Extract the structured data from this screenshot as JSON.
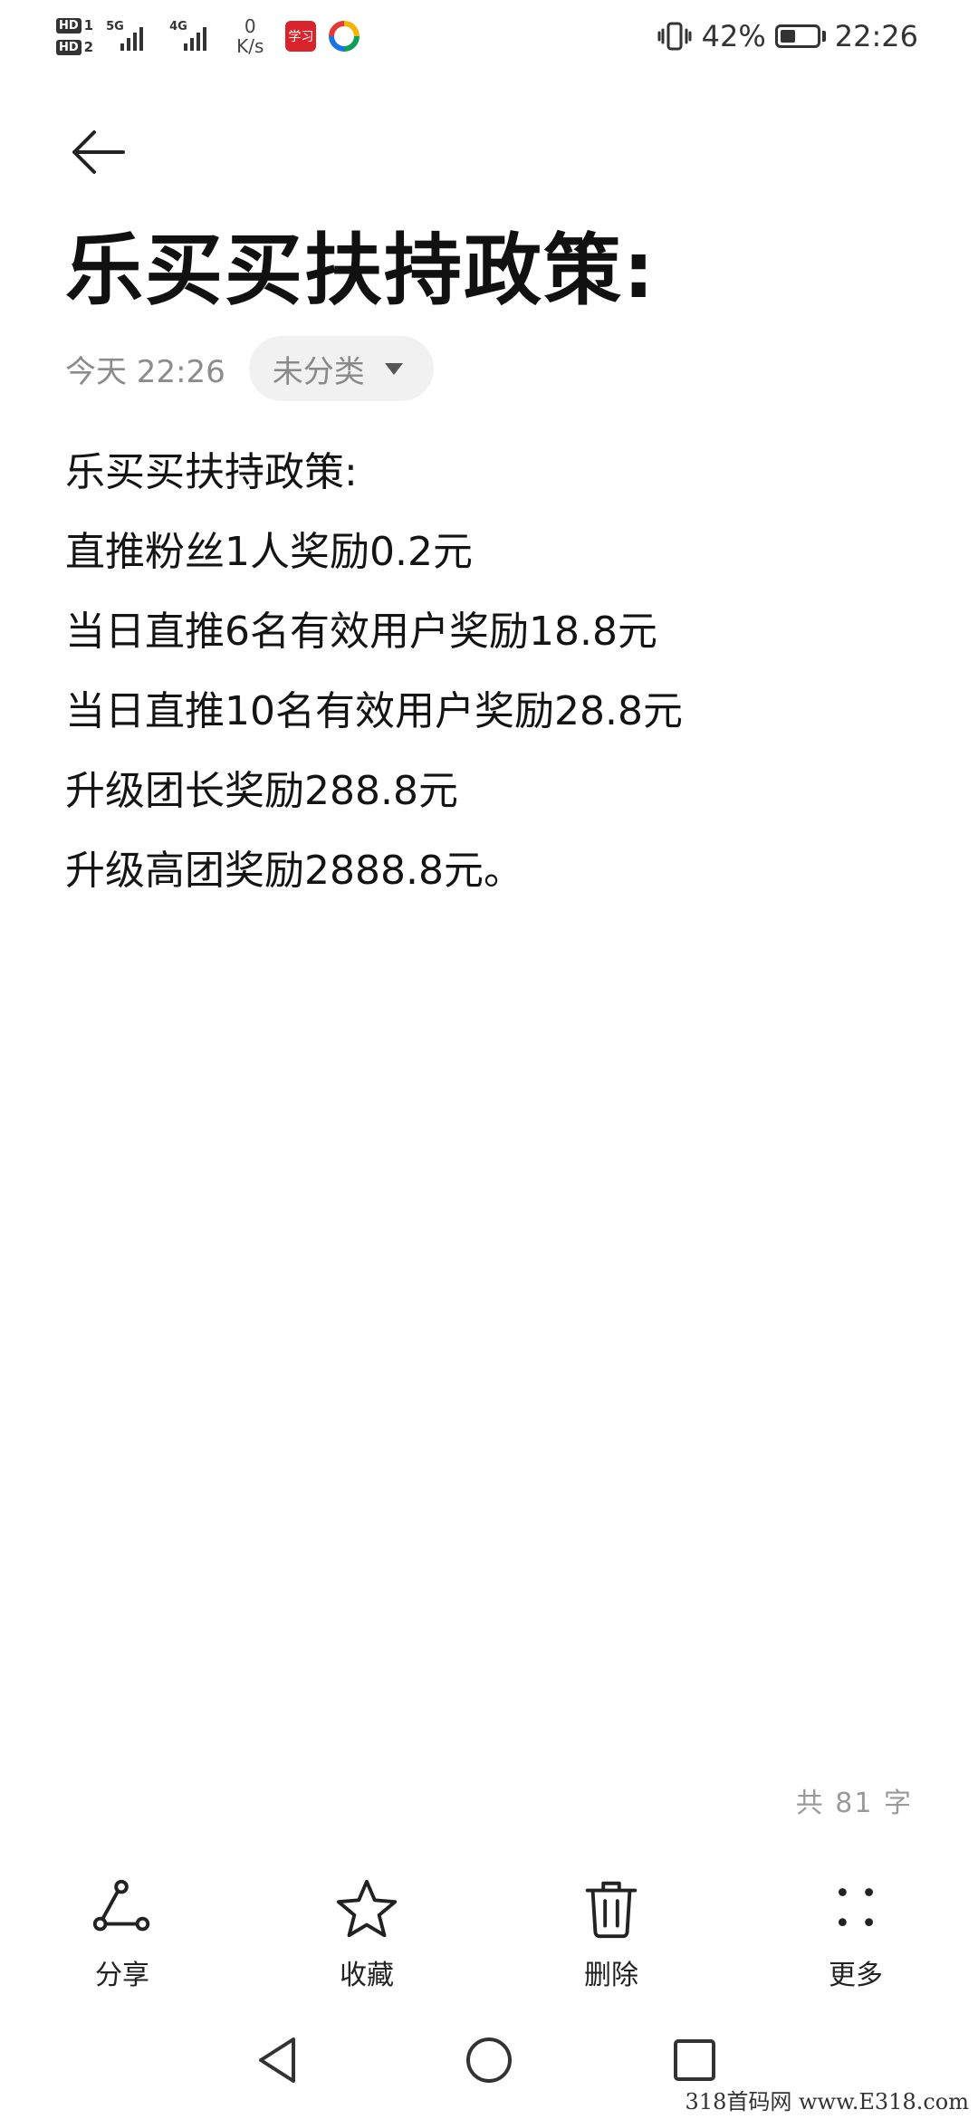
{
  "status_bar": {
    "sim1": "HD",
    "sim1_index": "1",
    "sim2": "HD",
    "sim2_index": "2",
    "network1": "5G",
    "network2": "4G",
    "speed_value": "0",
    "speed_unit": "K/s",
    "app_badge_text": "学习",
    "battery_percent": "42%",
    "battery_level": 0.42,
    "time": "22:26"
  },
  "note": {
    "title": "乐买买扶持政策:",
    "date": "今天 22:26",
    "category": "未分类",
    "lines": [
      "乐买买扶持政策:",
      "直推粉丝1人奖励0.2元",
      "当日直推6名有效用户奖励18.8元",
      "当日直推10名有效用户奖励28.8元",
      "升级团长奖励288.8元",
      "升级高团奖励2888.8元。"
    ],
    "word_count": "共 81 字"
  },
  "toolbar": {
    "share": "分享",
    "favorite": "收藏",
    "delete": "删除",
    "more": "更多"
  },
  "watermark": "318首码网 www.E318.com",
  "colors": {
    "background": "#ffffff",
    "text": "#141414",
    "muted": "#8c8c8c",
    "chip_bg": "#f1f1f1",
    "app_badge": "#d8242a"
  }
}
